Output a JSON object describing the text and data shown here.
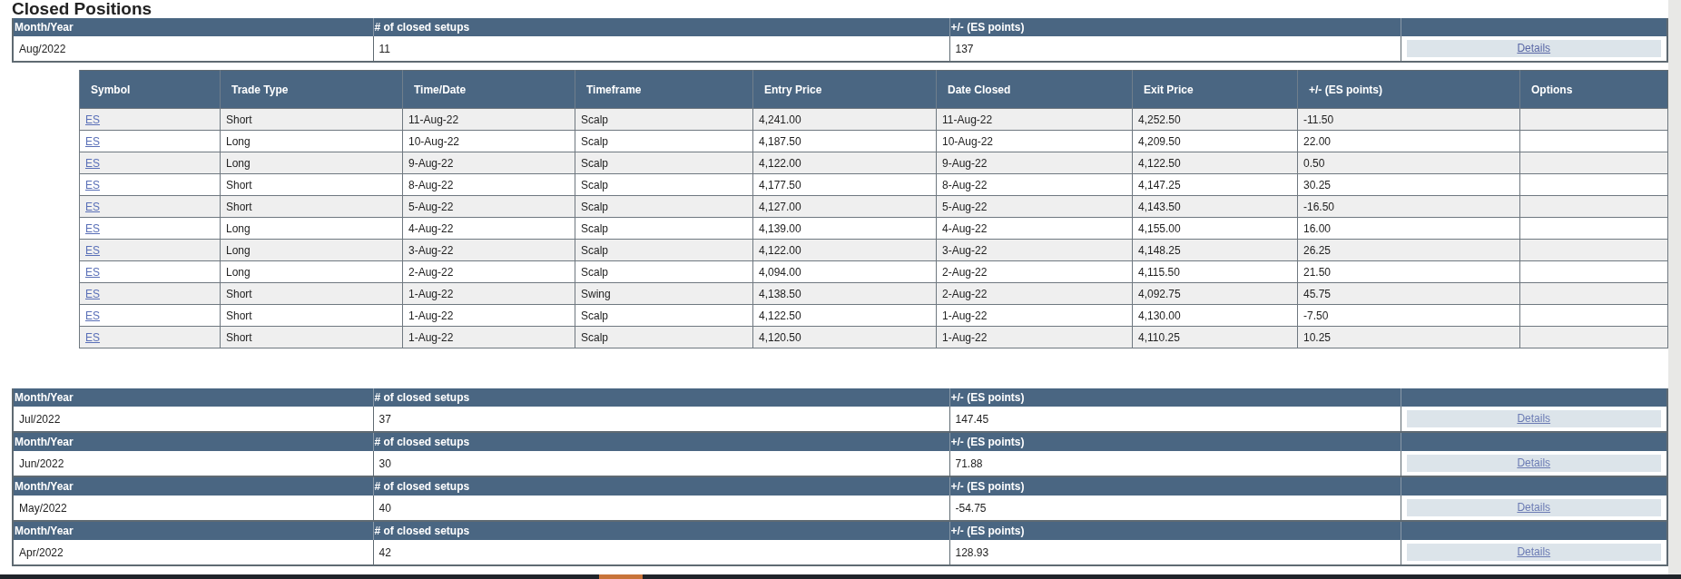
{
  "title": "Closed Positions",
  "months": [
    {
      "headers": [
        "Month/Year",
        "# of closed setups",
        "+/- (ES points)"
      ],
      "month": "Aug/2022",
      "setups": "11",
      "points": "137",
      "details": "Details",
      "expanded": true,
      "trades": {
        "columns": [
          "Symbol",
          "Trade Type",
          "Time/Date",
          "Timeframe",
          "Entry Price",
          "Date Closed",
          "Exit Price",
          "+/- (ES points)",
          "Options"
        ],
        "rows": [
          [
            "ES",
            "Short",
            "11-Aug-22",
            "Scalp",
            "4,241.00",
            "11-Aug-22",
            "4,252.50",
            "-11.50"
          ],
          [
            "ES",
            "Long",
            "10-Aug-22",
            "Scalp",
            "4,187.50",
            "10-Aug-22",
            "4,209.50",
            "22.00"
          ],
          [
            "ES",
            "Long",
            "9-Aug-22",
            "Scalp",
            "4,122.00",
            "9-Aug-22",
            "4,122.50",
            "0.50"
          ],
          [
            "ES",
            "Short",
            "8-Aug-22",
            "Scalp",
            "4,177.50",
            "8-Aug-22",
            "4,147.25",
            "30.25"
          ],
          [
            "ES",
            "Short",
            "5-Aug-22",
            "Scalp",
            "4,127.00",
            "5-Aug-22",
            "4,143.50",
            "-16.50"
          ],
          [
            "ES",
            "Long",
            "4-Aug-22",
            "Scalp",
            "4,139.00",
            "4-Aug-22",
            "4,155.00",
            "16.00"
          ],
          [
            "ES",
            "Long",
            "3-Aug-22",
            "Scalp",
            "4,122.00",
            "3-Aug-22",
            "4,148.25",
            "26.25"
          ],
          [
            "ES",
            "Long",
            "2-Aug-22",
            "Scalp",
            "4,094.00",
            "2-Aug-22",
            "4,115.50",
            "21.50"
          ],
          [
            "ES",
            "Short",
            "1-Aug-22",
            "Swing",
            "4,138.50",
            "2-Aug-22",
            "4,092.75",
            "45.75"
          ],
          [
            "ES",
            "Short",
            "1-Aug-22",
            "Scalp",
            "4,122.50",
            "1-Aug-22",
            "4,130.00",
            "-7.50"
          ],
          [
            "ES",
            "Short",
            "1-Aug-22",
            "Scalp",
            "4,120.50",
            "1-Aug-22",
            "4,110.25",
            "10.25"
          ]
        ]
      }
    },
    {
      "headers": [
        "Month/Year",
        "# of closed setups",
        "+/- (ES points)"
      ],
      "month": "Jul/2022",
      "setups": "37",
      "points": "147.45",
      "details": "Details",
      "expanded": false
    },
    {
      "headers": [
        "Month/Year",
        "# of closed setups",
        "+/- (ES points)"
      ],
      "month": "Jun/2022",
      "setups": "30",
      "points": "71.88",
      "details": "Details",
      "expanded": false
    },
    {
      "headers": [
        "Month/Year",
        "# of closed setups",
        "+/- (ES points)"
      ],
      "month": "May/2022",
      "setups": "40",
      "points": "-54.75",
      "details": "Details",
      "expanded": false
    },
    {
      "headers": [
        "Month/Year",
        "# of closed setups",
        "+/- (ES points)"
      ],
      "month": "Apr/2022",
      "setups": "42",
      "points": "128.93",
      "details": "Details",
      "expanded": false
    }
  ]
}
